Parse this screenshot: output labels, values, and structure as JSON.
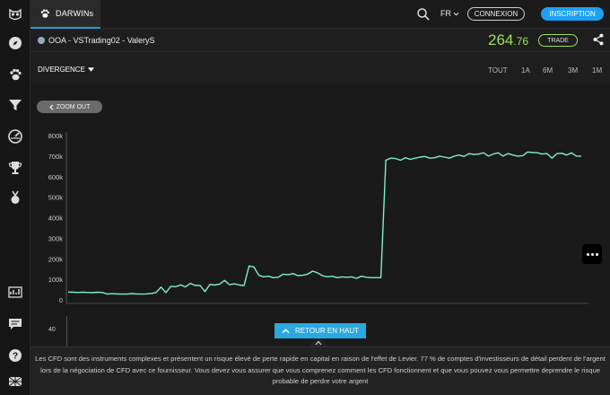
{
  "topbar": {
    "tab_label": "DARWINs",
    "language": "FR",
    "connexion_label": "CONNEXION",
    "inscription_label": "INSCRIPTION"
  },
  "product": {
    "name": "OOA - VSTrading02 - ValeryS",
    "price_main": "264",
    "price_decimals": ".76",
    "trade_label": "TRADE"
  },
  "toolbar": {
    "metric": "DIVERGENCE",
    "ranges": [
      "TOUT",
      "1A",
      "6M",
      "3M",
      "1M"
    ]
  },
  "chart": {
    "zoom_out_label": "ZOOM OUT",
    "sub_tick": "40",
    "retour_label": "RETOUR EN HAUT"
  },
  "colors": {
    "accent": "#2aa8e0",
    "line": "#7ef0c8",
    "price": "#9be15d"
  },
  "chart_data": {
    "type": "line",
    "title": "",
    "xlabel": "",
    "ylabel": "",
    "ylim": [
      0,
      800000
    ],
    "y_ticks": [
      "0",
      "100k",
      "200k",
      "300k",
      "400k",
      "500k",
      "600k",
      "700k",
      "800k"
    ],
    "grid": false,
    "series": [
      {
        "values": [
          38000,
          37000,
          36000,
          37000,
          36000,
          35000,
          37000,
          36000,
          28000,
          30000,
          29000,
          28000,
          28000,
          30000,
          29000,
          28000,
          29000,
          31000,
          36000,
          62000,
          35000,
          66000,
          64000,
          73000,
          63000,
          80000,
          70000,
          70000,
          40000,
          75000,
          72000,
          76000,
          95000,
          74000,
          78000,
          72000,
          70000,
          165000,
          160000,
          120000,
          112000,
          115000,
          108000,
          110000,
          125000,
          122000,
          128000,
          118000,
          120000,
          125000,
          140000,
          132000,
          118000,
          112000,
          115000,
          108000,
          112000,
          110000,
          112000,
          105000,
          115000,
          110000,
          108000,
          108000,
          108000,
          680000,
          690000,
          688000,
          680000,
          692000,
          684000,
          690000,
          695000,
          698000,
          690000,
          692000,
          700000,
          695000,
          690000,
          700000,
          705000,
          698000,
          712000,
          708000,
          710000,
          716000,
          700000,
          710000,
          716000,
          700000,
          712000,
          705000,
          700000,
          702000,
          720000,
          718000,
          716000,
          710000,
          712000,
          690000,
          712000,
          714000,
          705000,
          716000,
          700000,
          700000
        ]
      }
    ]
  },
  "disclaimer": "Les CFD sont des instruments complexes et présentent un risque élevé de perte rapide en capital en raison de l'effet de Levier. 77 % de comptes d'investisseurs de détail perdent de l'argent lors de la négociation de CFD avec ce fournisseur. Vous devez vous assurer que vous comprenez comment les CFD fonctionnent et que vous pouvez vous permettre deprendre le risque probable de perdre votre argent"
}
